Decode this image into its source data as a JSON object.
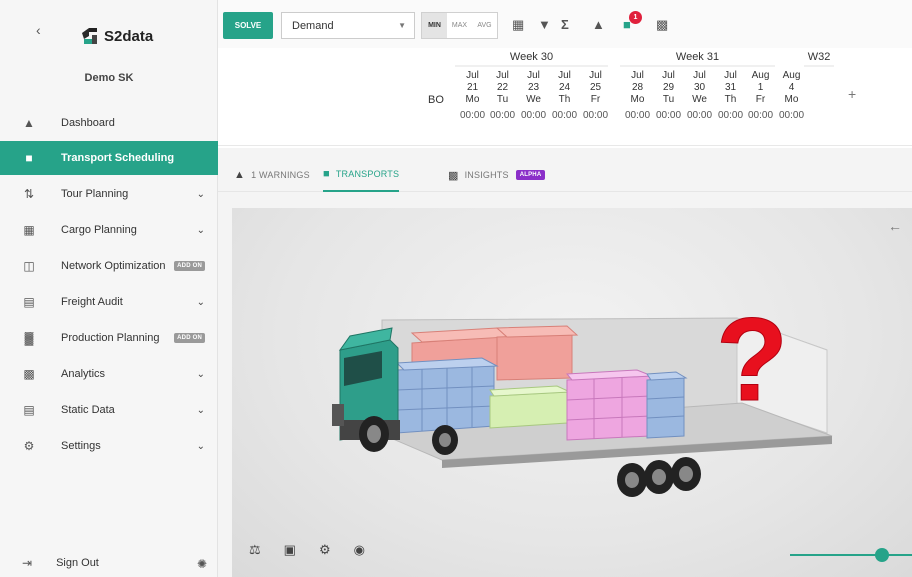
{
  "sidebar": {
    "logo_text": "S2data",
    "company": "Demo SK",
    "items": [
      {
        "label": "Dashboard",
        "icon": "home-icon",
        "chevron": false
      },
      {
        "label": "Transport Scheduling",
        "icon": "truck-icon",
        "active": true
      },
      {
        "label": "Tour Planning",
        "icon": "route-icon",
        "chevron": true
      },
      {
        "label": "Cargo Planning",
        "icon": "grid-icon",
        "chevron": true
      },
      {
        "label": "Network Optimization",
        "icon": "network-icon",
        "badge": "ADD ON"
      },
      {
        "label": "Freight Audit",
        "icon": "document-icon",
        "chevron": true
      },
      {
        "label": "Production Planning",
        "icon": "factory-icon",
        "badge": "ADD ON"
      },
      {
        "label": "Analytics",
        "icon": "chart-icon",
        "chevron": true
      },
      {
        "label": "Static Data",
        "icon": "database-icon",
        "chevron": true
      },
      {
        "label": "Settings",
        "icon": "gear-icon",
        "chevron": true
      }
    ],
    "sign_out": "Sign Out"
  },
  "toolbar": {
    "solve_label": "SOLVE",
    "demand_value": "Demand",
    "agg": [
      "MIN",
      "MAX",
      "AVG"
    ],
    "warning_count": "1"
  },
  "calendar": {
    "row_label": "BO",
    "weeks": [
      "Week 30",
      "Week 31",
      "W32"
    ],
    "days": [
      {
        "m": "Jul",
        "d": "21",
        "w": "Mo",
        "t": "00:00"
      },
      {
        "m": "Jul",
        "d": "22",
        "w": "Tu",
        "t": "00:00"
      },
      {
        "m": "Jul",
        "d": "23",
        "w": "We",
        "t": "00:00"
      },
      {
        "m": "Jul",
        "d": "24",
        "w": "Th",
        "t": "00:00"
      },
      {
        "m": "Jul",
        "d": "25",
        "w": "Fr",
        "t": "00:00"
      },
      {
        "m": "Jul",
        "d": "28",
        "w": "Mo",
        "t": "00:00"
      },
      {
        "m": "Jul",
        "d": "29",
        "w": "Tu",
        "t": "00:00"
      },
      {
        "m": "Jul",
        "d": "30",
        "w": "We",
        "t": "00:00"
      },
      {
        "m": "Jul",
        "d": "31",
        "w": "Th",
        "t": "00:00"
      },
      {
        "m": "Aug",
        "d": "1",
        "w": "Fr",
        "t": "00:00"
      },
      {
        "m": "Aug",
        "d": "4",
        "w": "Mo",
        "t": "00:00"
      }
    ]
  },
  "tabs": {
    "warnings": "1 WARNINGS",
    "transports": "TRANSPORTS",
    "insights": "INSIGHTS",
    "alpha": "ALPHA"
  },
  "overlay": {
    "mark": "?"
  },
  "colors": {
    "accent": "#26a389",
    "alert": "#e0203c",
    "alpha": "#8b2fc9",
    "question": "#e8101e"
  }
}
